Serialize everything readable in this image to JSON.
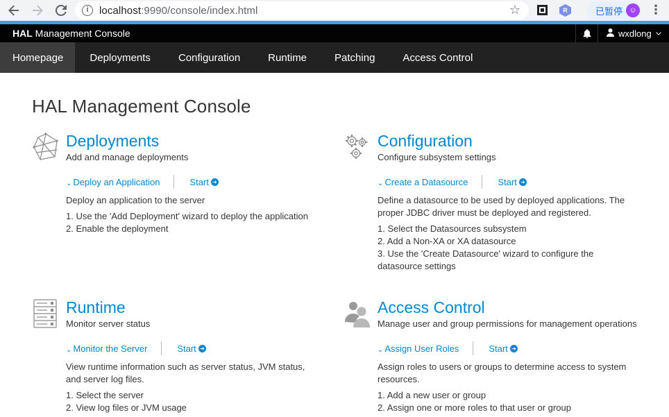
{
  "browser": {
    "url_host": "localhost",
    "url_path": ":9990/console/index.html",
    "paused_label": "已暂停",
    "ext_label": "R",
    "avatar_letter": "ⓟ"
  },
  "header": {
    "brand_bold": "HAL",
    "brand_rest": " Management Console",
    "user_name": "wxdlong"
  },
  "nav": {
    "tabs": [
      {
        "label": "Homepage",
        "active": true
      },
      {
        "label": "Deployments",
        "active": false
      },
      {
        "label": "Configuration",
        "active": false
      },
      {
        "label": "Runtime",
        "active": false
      },
      {
        "label": "Patching",
        "active": false
      },
      {
        "label": "Access Control",
        "active": false
      }
    ]
  },
  "page_title": "HAL Management Console",
  "sections": [
    {
      "title": "Deployments",
      "desc": "Add and manage deployments",
      "action": "Deploy an Application",
      "start": "Start",
      "body": "Deploy an application to the server",
      "steps": [
        "1. Use the 'Add Deployment' wizard to deploy the application",
        "2. Enable the deployment"
      ]
    },
    {
      "title": "Configuration",
      "desc": "Configure subsystem settings",
      "action": "Create a Datasource",
      "start": "Start",
      "body": "Define a datasource to be used by deployed applications. The proper JDBC driver must be deployed and registered.",
      "steps": [
        "1. Select the Datasources subsystem",
        "2. Add a Non-XA or XA datasource",
        "3. Use the 'Create Datasource' wizard to configure the datasource settings"
      ]
    },
    {
      "title": "Runtime",
      "desc": "Monitor server status",
      "action": "Monitor the Server",
      "start": "Start",
      "body": "View runtime information such as server status, JVM status, and server log files.",
      "steps": [
        "1. Select the server",
        "2. View log files or JVM usage"
      ]
    },
    {
      "title": "Access Control",
      "desc": "Manage user and group permissions for management operations",
      "action": "Assign User Roles",
      "start": "Start",
      "body": "Assign roles to users or groups to determine access to system resources.",
      "steps": [
        "1. Add a new user or group",
        "2. Assign one or more roles to that user or group"
      ]
    }
  ],
  "colors": {
    "accent": "#0088ce",
    "stripe": "#39a5dc",
    "header_bg": "#030303",
    "nav_bg": "#222222"
  }
}
